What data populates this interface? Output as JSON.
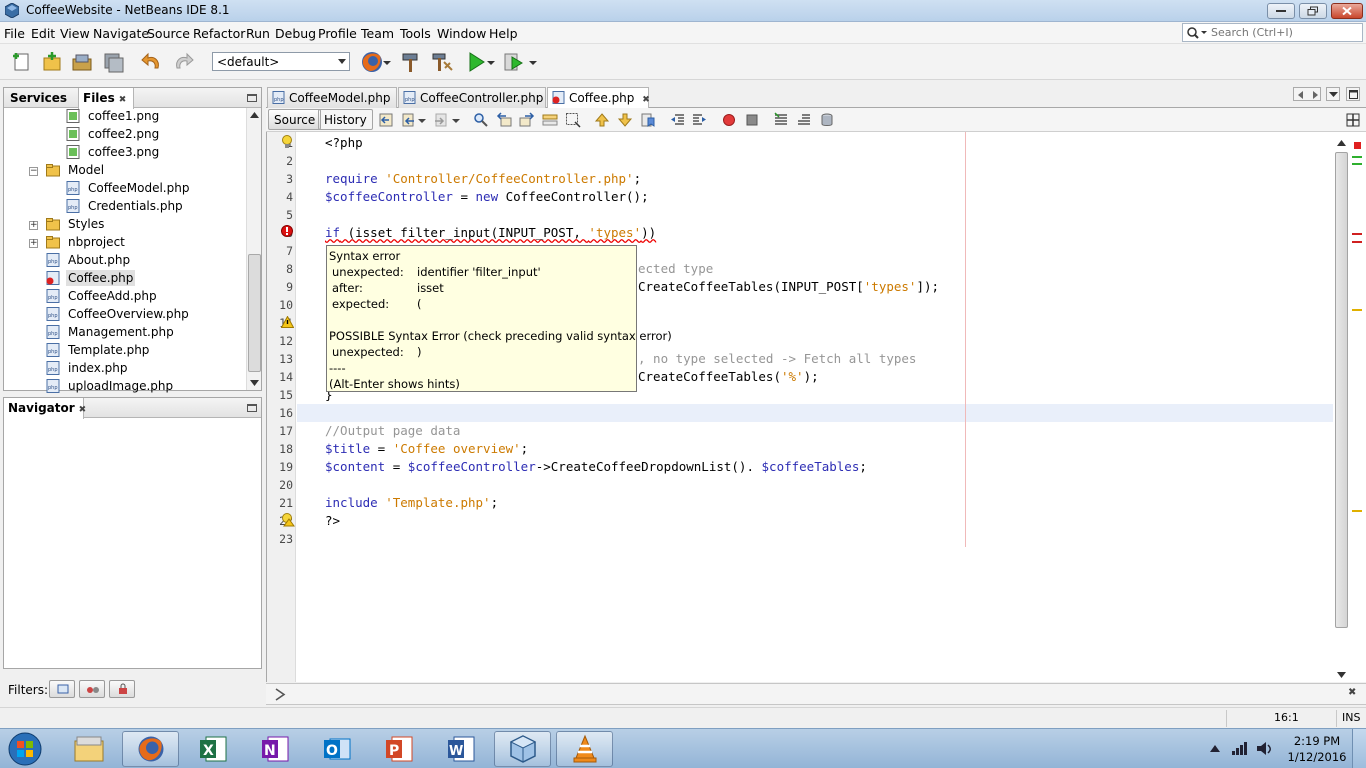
{
  "window": {
    "title": "CoffeeWebsite - NetBeans IDE 8.1"
  },
  "menu": [
    "File",
    "Edit",
    "View",
    "Navigate",
    "Source",
    "Refactor",
    "Run",
    "Debug",
    "Profile",
    "Team",
    "Tools",
    "Window",
    "Help"
  ],
  "search": {
    "placeholder": "Search (Ctrl+I)"
  },
  "toolbar": {
    "config_value": "<default>"
  },
  "left_panel": {
    "tabs": [
      "Services",
      "Files"
    ],
    "tree": [
      {
        "label": "coffee1.png",
        "type": "png"
      },
      {
        "label": "coffee2.png",
        "type": "png"
      },
      {
        "label": "coffee3.png",
        "type": "png"
      },
      {
        "label": "Model",
        "type": "folder"
      },
      {
        "label": "CoffeeModel.php",
        "type": "php"
      },
      {
        "label": "Credentials.php",
        "type": "php"
      },
      {
        "label": "Styles",
        "type": "folder"
      },
      {
        "label": "nbproject",
        "type": "folder"
      },
      {
        "label": "About.php",
        "type": "php"
      },
      {
        "label": "Coffee.php",
        "type": "php-error"
      },
      {
        "label": "CoffeeAdd.php",
        "type": "php"
      },
      {
        "label": "CoffeeOverview.php",
        "type": "php"
      },
      {
        "label": "Management.php",
        "type": "php"
      },
      {
        "label": "Template.php",
        "type": "php"
      },
      {
        "label": "index.php",
        "type": "php"
      },
      {
        "label": "uploadImage.php",
        "type": "php"
      }
    ]
  },
  "navigator": {
    "title": "Navigator"
  },
  "filters": {
    "label": "Filters:"
  },
  "editor": {
    "tabs": [
      "CoffeeModel.php",
      "CoffeeController.php",
      "Coffee.php"
    ],
    "active_tab": "Coffee.php",
    "source_label": "Source",
    "history_label": "History",
    "line_numbers": [
      "1",
      "2",
      "3",
      "4",
      "5",
      "6",
      "7",
      "8",
      "9",
      "10",
      "11",
      "12",
      "13",
      "14",
      "15",
      "16",
      "17",
      "18",
      "19",
      "20",
      "21",
      "22",
      "23"
    ],
    "code": {
      "l1": "<?php",
      "l3a": "require ",
      "l3b": "'Controller/CoffeeController.php'",
      "l3c": ";",
      "l4a": "$coffeeController",
      "l4b": " = ",
      "l4c": "new",
      "l4d": " CoffeeController();",
      "l6a": "if",
      "l6b": " (isset filter_input(INPUT_POST, ",
      "l6c": "'types'",
      "l6d": "))",
      "l8": "ected type",
      "l9a": "CreateCoffeeTables(INPUT_POST[",
      "l9b": "'types'",
      "l9c": "]);",
      "l13": ", no type selected -> Fetch all types",
      "l14a": "CreateCoffeeTables(",
      "l14b": "'%'",
      "l14c": ");",
      "l15": "}",
      "l17": "//Output page data",
      "l18a": "$title",
      "l18b": " = ",
      "l18c": "'Coffee overview'",
      "l18d": ";",
      "l19a": "$content",
      "l19b": " = ",
      "l19c": "$coffeeController",
      "l19d": "->CreateCoffeeDropdownList(). ",
      "l19e": "$coffeeTables",
      "l19f": ";",
      "l21a": "include ",
      "l21b": "'Template.php'",
      "l21c": ";",
      "l22": "?>"
    },
    "tooltip": {
      "title": "Syntax error",
      "r1k": "unexpected:",
      "r1v": "identifier 'filter_input'",
      "r2k": "after:",
      "r2v": "isset",
      "r3k": "expected:",
      "r3v": "(",
      "possible": "POSSIBLE Syntax Error (check preceding valid syntax error)",
      "r4k": "unexpected:",
      "r4v": ")",
      "sep": "----",
      "hint": "(Alt-Enter shows hints)"
    }
  },
  "status": {
    "position": "16:1",
    "mode": "INS"
  },
  "taskbar": {
    "time": "2:19 PM",
    "date": "1/12/2016",
    "apps": [
      "start-orb",
      "file-explorer",
      "firefox",
      "excel",
      "onenote",
      "outlook",
      "powerpoint",
      "word",
      "virtualbox",
      "vlc"
    ]
  },
  "colors": {
    "keyword": "#2d2db4",
    "string": "#cc7a00",
    "comment": "#969696",
    "tooltip_bg": "#ffffe1",
    "error": "#e00000"
  }
}
